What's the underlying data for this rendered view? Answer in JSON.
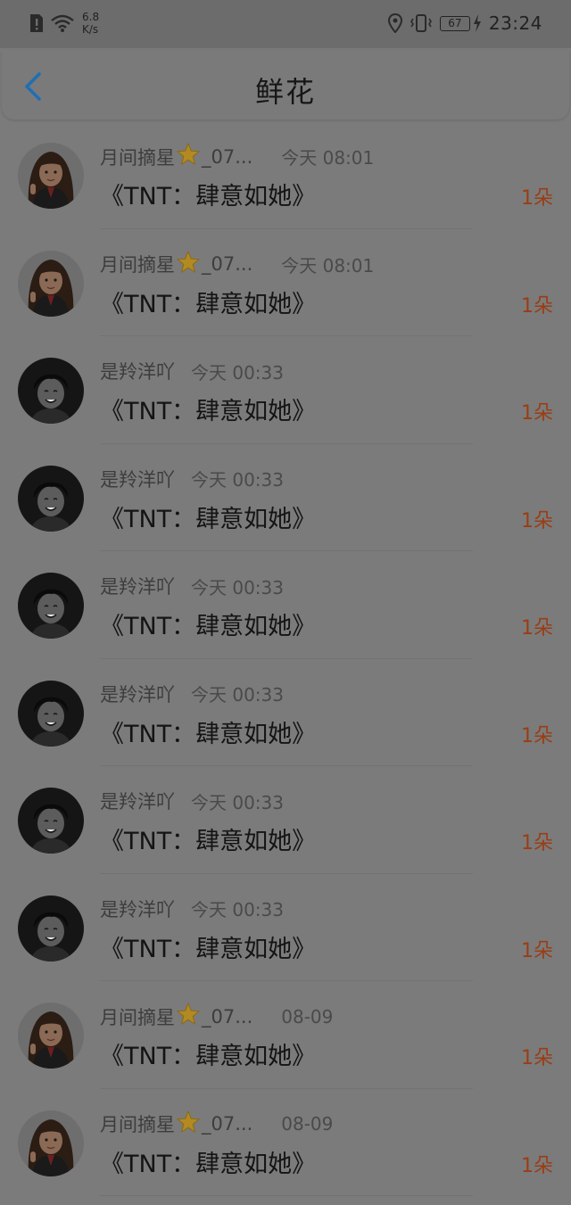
{
  "status_bar": {
    "speed_value": "6.8",
    "speed_unit": "K/s",
    "battery": "67",
    "time": "23:24"
  },
  "header": {
    "title": "鲜花",
    "back_icon": "chevron-left-icon"
  },
  "accent_color": "#1e6fb5",
  "count_color": "#9a3d14",
  "items": [
    {
      "avatar": "girl",
      "user": "月间摘星",
      "suffix": "_07...",
      "time": "今天 08:01",
      "title": "《TNT：肆意如她》",
      "count": "1朵"
    },
    {
      "avatar": "girl",
      "user": "月间摘星",
      "suffix": "_07...",
      "time": "今天 08:01",
      "title": "《TNT：肆意如她》",
      "count": "1朵"
    },
    {
      "avatar": "boy",
      "user": "是羚洋吖",
      "suffix": "",
      "time": "今天 00:33",
      "title": "《TNT：肆意如她》",
      "count": "1朵"
    },
    {
      "avatar": "boy",
      "user": "是羚洋吖",
      "suffix": "",
      "time": "今天 00:33",
      "title": "《TNT：肆意如她》",
      "count": "1朵"
    },
    {
      "avatar": "boy",
      "user": "是羚洋吖",
      "suffix": "",
      "time": "今天 00:33",
      "title": "《TNT：肆意如她》",
      "count": "1朵"
    },
    {
      "avatar": "boy",
      "user": "是羚洋吖",
      "suffix": "",
      "time": "今天 00:33",
      "title": "《TNT：肆意如她》",
      "count": "1朵"
    },
    {
      "avatar": "boy",
      "user": "是羚洋吖",
      "suffix": "",
      "time": "今天 00:33",
      "title": "《TNT：肆意如她》",
      "count": "1朵"
    },
    {
      "avatar": "boy",
      "user": "是羚洋吖",
      "suffix": "",
      "time": "今天 00:33",
      "title": "《TNT：肆意如她》",
      "count": "1朵"
    },
    {
      "avatar": "girl",
      "user": "月间摘星",
      "suffix": "_07...",
      "time": "08-09",
      "title": "《TNT：肆意如她》",
      "count": "1朵"
    },
    {
      "avatar": "girl",
      "user": "月间摘星",
      "suffix": "_07...",
      "time": "08-09",
      "title": "《TNT：肆意如她》",
      "count": "1朵"
    }
  ]
}
